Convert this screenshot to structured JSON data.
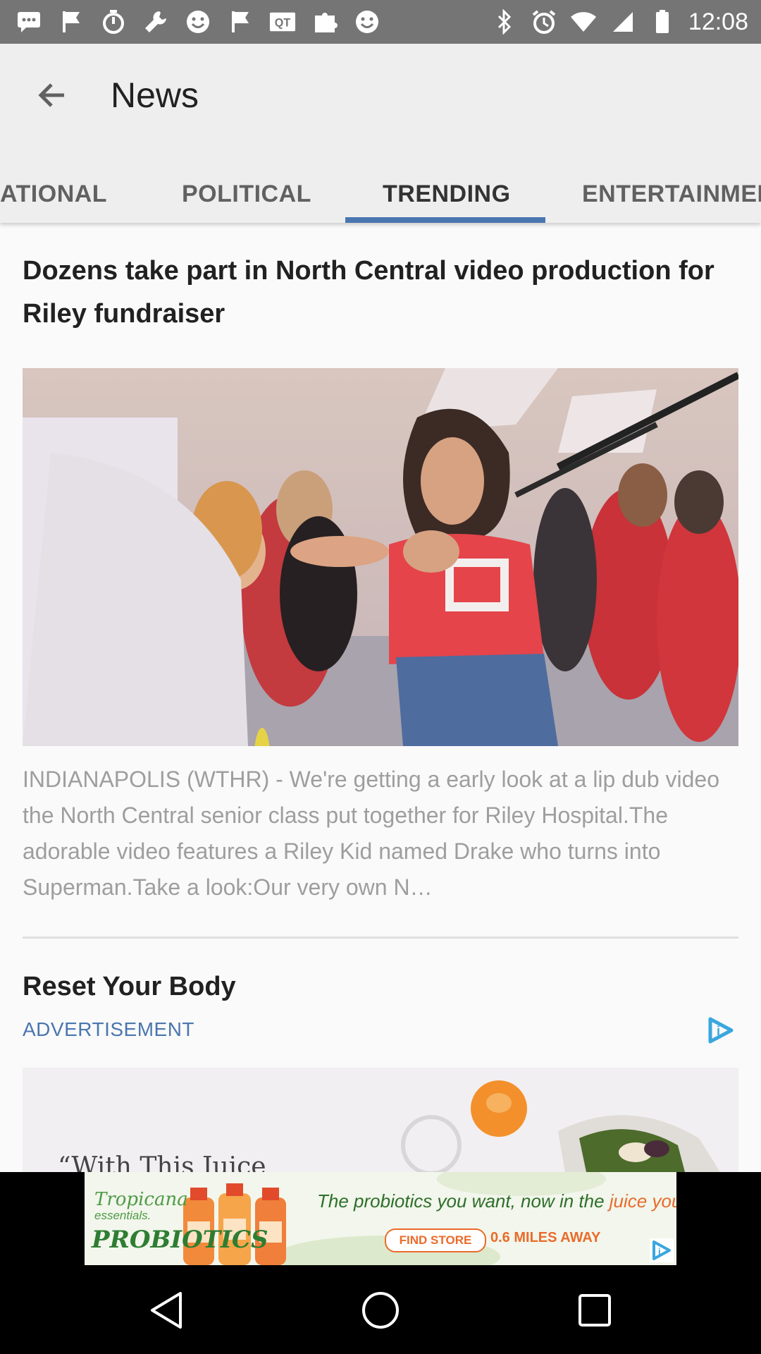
{
  "status_bar": {
    "time": "12:08",
    "icons": [
      "message-icon",
      "flag-icon",
      "timer-icon",
      "wrench-icon",
      "smiley-icon",
      "flag-icon",
      "qr-icon",
      "puzzle-icon",
      "smiley-icon",
      "bluetooth-icon",
      "alarm-icon",
      "wifi-icon",
      "signal-icon",
      "battery-icon"
    ]
  },
  "app_bar": {
    "title": "News",
    "tabs": [
      {
        "label": "ATIONAL",
        "active": false
      },
      {
        "label": "POLITICAL",
        "active": false
      },
      {
        "label": "TRENDING",
        "active": true
      },
      {
        "label": "ENTERTAINMEN",
        "active": false
      }
    ],
    "accent_color": "#4a76b0"
  },
  "article": {
    "headline": "Dozens take part in North Central video production for Riley fundraiser",
    "summary": "INDIANAPOLIS (WTHR) - We're getting a early look at a lip dub video the North Central senior class put together for Riley Hospital.The adorable video features a Riley Kid named Drake who turns into Superman.Take a look:Our very own N…"
  },
  "sponsored": {
    "title": "Reset Your Body",
    "label": "ADVERTISEMENT"
  },
  "banner_ad": {
    "brand_line1": "Tropicana",
    "brand_line2": "essentials.",
    "brand_line3": "PROBIOTICS",
    "headline_pre": "The probiotics you want, now in the ",
    "headline_highlight": "juice you love",
    "cta": "FIND STORE",
    "distance": "0.6 MILES AWAY"
  },
  "nav_bar": {
    "buttons": [
      "back-icon",
      "home-icon",
      "recents-icon"
    ]
  }
}
